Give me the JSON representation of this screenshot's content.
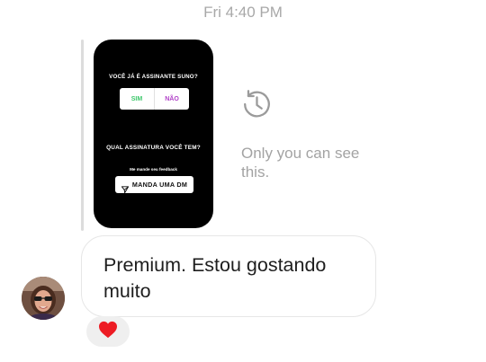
{
  "thread": {
    "timestamp": "Fri 4:40 PM"
  },
  "story_reply": {
    "question_1": "VOCÊ JÁ É ASSINANTE SUNO?",
    "poll_options": [
      "SIM",
      "NÃO"
    ],
    "question_2": "QUAL ASSINATURA VOCÊ TEM?",
    "note": "Me mande seu feedback",
    "dm_button_label": "MANDA UMA DM",
    "dm_icon": "send-icon",
    "visibility_icon": "history-icon",
    "visibility_text": "Only you can see this.",
    "colors": {
      "card_background": "#000000",
      "sim": "#3cc76a",
      "nao": "#b040c8"
    }
  },
  "message": {
    "avatar": "avatar",
    "text": "Premium. Estou gostando muito",
    "reaction": "heart-icon",
    "reaction_color": "#ed1c24"
  }
}
